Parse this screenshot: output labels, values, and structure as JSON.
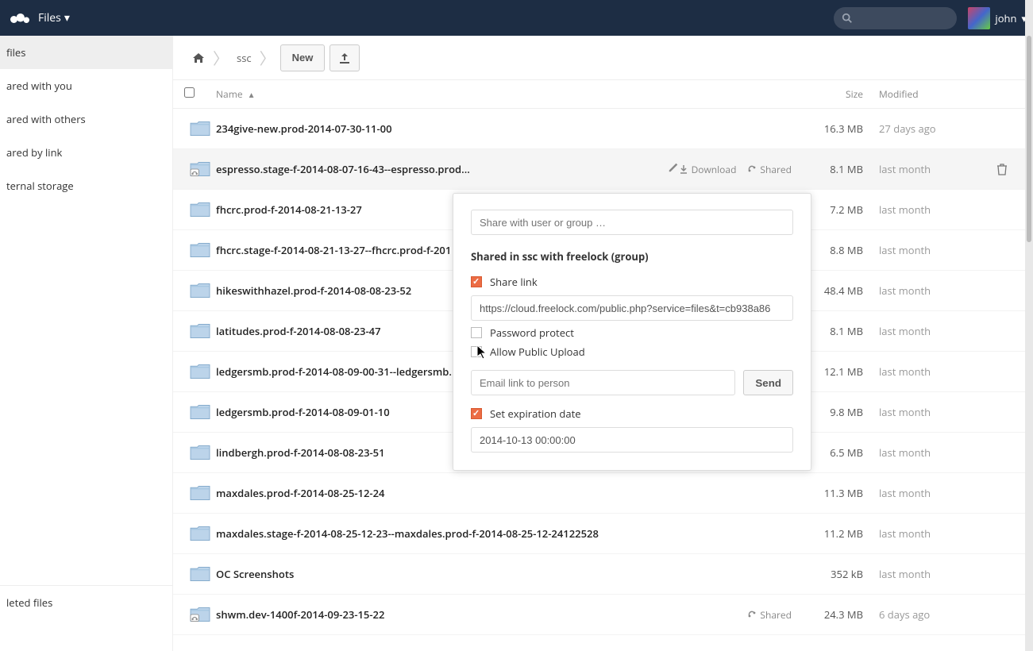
{
  "header": {
    "app_label": "Files",
    "user": "john"
  },
  "sidebar": {
    "items": [
      {
        "label": "files",
        "active": true
      },
      {
        "label": "ared with you"
      },
      {
        "label": "ared with others"
      },
      {
        "label": "ared by link"
      },
      {
        "label": "ternal storage"
      }
    ],
    "deleted": "leted files"
  },
  "breadcrumbs": {
    "folder": "ssc"
  },
  "controls": {
    "new_label": "New"
  },
  "columns": {
    "name": "Name",
    "size": "Size",
    "modified": "Modified"
  },
  "rows": [
    {
      "name": "234give-new.prod-2014-07-30-11-00",
      "size": "16.3 MB",
      "mod": "27 days ago",
      "icon": "folder",
      "actions": null,
      "selected": false
    },
    {
      "name": "espresso.stage-f-2014-08-07-16-43--espresso.prod...",
      "size": "8.1 MB",
      "mod": "last month",
      "icon": "folder-shared",
      "actions": {
        "download": "Download",
        "shared": "Shared",
        "trash": true,
        "pencil": true
      },
      "selected": true
    },
    {
      "name": "fhcrc.prod-f-2014-08-21-13-27",
      "size": "7.2 MB",
      "mod": "last month",
      "icon": "folder",
      "actions": null,
      "selected": false
    },
    {
      "name": "fhcrc.stage-f-2014-08-21-13-27--fhcrc.prod-f-201",
      "size": "8.8 MB",
      "mod": "last month",
      "icon": "folder",
      "actions": null,
      "selected": false
    },
    {
      "name": "hikeswithhazel.prod-f-2014-08-08-23-52",
      "size": "48.4 MB",
      "mod": "last month",
      "icon": "folder",
      "actions": null,
      "selected": false
    },
    {
      "name": "latitudes.prod-f-2014-08-08-23-47",
      "size": "8.1 MB",
      "mod": "last month",
      "icon": "folder",
      "actions": null,
      "selected": false
    },
    {
      "name": "ledgersmb.prod-f-2014-08-09-00-31--ledgersmb.",
      "size": "12.1 MB",
      "mod": "last month",
      "icon": "folder",
      "actions": null,
      "selected": false
    },
    {
      "name": "ledgersmb.prod-f-2014-08-09-01-10",
      "size": "9.8 MB",
      "mod": "last month",
      "icon": "folder",
      "actions": null,
      "selected": false
    },
    {
      "name": "lindbergh.prod-f-2014-08-08-23-51",
      "size": "6.5 MB",
      "mod": "last month",
      "icon": "folder",
      "actions": null,
      "selected": false
    },
    {
      "name": "maxdales.prod-f-2014-08-25-12-24",
      "size": "11.3 MB",
      "mod": "last month",
      "icon": "folder",
      "actions": null,
      "selected": false
    },
    {
      "name": "maxdales.stage-f-2014-08-25-12-23--maxdales.prod-f-2014-08-25-12-24122528",
      "size": "11.2 MB",
      "mod": "last month",
      "icon": "folder",
      "actions": null,
      "selected": false
    },
    {
      "name": "OC Screenshots",
      "size": "352 kB",
      "mod": "last month",
      "icon": "folder",
      "actions": null,
      "selected": false
    },
    {
      "name": "shwm.dev-1400f-2014-09-23-15-22",
      "size": "24.3 MB",
      "mod": "6 days ago",
      "icon": "folder-shared",
      "actions": {
        "shared": "Shared"
      },
      "selected": false
    }
  ],
  "popover": {
    "share_placeholder": "Share with user or group …",
    "shared_title": "Shared in ssc with freelock (group)",
    "share_link_label": "Share link",
    "share_link_url": "https://cloud.freelock.com/public.php?service=files&t=cb938a86",
    "password_label": "Password protect",
    "public_upload_label": "Allow Public Upload",
    "email_placeholder": "Email link to person",
    "send_label": "Send",
    "expiration_label": "Set expiration date",
    "expiration_value": "2014-10-13 00:00:00"
  }
}
